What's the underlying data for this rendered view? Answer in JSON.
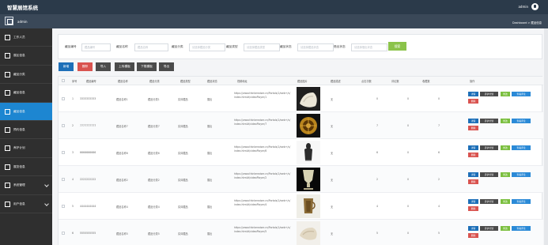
{
  "app": {
    "title": "智慧展馆系统",
    "user": "admin",
    "home_label": "admin",
    "breadcrumb": "Dashboard > 藏品信息"
  },
  "sidebar": {
    "items": [
      {
        "label": "工作人员",
        "active": false,
        "icon": "user-icon",
        "arrow": false
      },
      {
        "label": "展区信息",
        "active": false,
        "icon": "photo-icon",
        "arrow": false
      },
      {
        "label": "藏品分类",
        "active": false,
        "icon": "list-icon",
        "arrow": false
      },
      {
        "label": "藏品信息",
        "active": false,
        "icon": "grid-icon",
        "arrow": false
      },
      {
        "label": "藏品信息",
        "active": true,
        "icon": "grid-icon",
        "arrow": false
      },
      {
        "label": "预约信息",
        "active": false,
        "icon": "send-icon",
        "arrow": false
      },
      {
        "label": "养护计划",
        "active": false,
        "icon": "check-icon",
        "arrow": false
      },
      {
        "label": "展览信息",
        "active": false,
        "icon": "edit-icon",
        "arrow": false
      },
      {
        "label": "系统管理",
        "active": false,
        "icon": "file-icon",
        "arrow": true
      },
      {
        "label": "用户信息",
        "active": false,
        "icon": "chat-icon",
        "arrow": true
      }
    ]
  },
  "filters": [
    {
      "label": "藏品编号",
      "placeholder": "藏品编号"
    },
    {
      "label": "藏品名称",
      "placeholder": "藏品名称"
    },
    {
      "label": "藏品分类",
      "placeholder": "请选择藏品分类"
    },
    {
      "label": "藏品类型",
      "placeholder": "请选择藏品类型"
    },
    {
      "label": "藏品状态",
      "placeholder": "请选择藏品状态"
    },
    {
      "label": "借出状态",
      "placeholder": "请选择借出状态"
    }
  ],
  "search_label": "搜索",
  "actions": [
    {
      "label": "新增",
      "color": "#1d6fb8"
    },
    {
      "label": "删除",
      "color": "#d9534f"
    },
    {
      "label": "导入",
      "color": "#4b4b4b"
    },
    {
      "label": "上传模板",
      "color": "#4b4b4b"
    },
    {
      "label": "下载模板",
      "color": "#4b4b4b"
    },
    {
      "label": "导出",
      "color": "#4b4b4b"
    }
  ],
  "table": {
    "headers": [
      "序号",
      "藏品编号",
      "藏品名称",
      "藏品分类",
      "藏品类型",
      "藏品状态",
      "视频地址",
      "藏品图片",
      "藏品描述",
      "点击次数",
      "评论数",
      "收藏数",
      "操作"
    ],
    "rows": [
      {
        "no": "1",
        "code": "3333333333",
        "name": "藏品名称1",
        "category": "藏品分类1",
        "type": "实体藏品",
        "status": "展出",
        "url": "https://www.thinkerwiser.cn/Portals/1/web+/v/index.html#/videoPlayer/1",
        "desc": "无",
        "clicks": "0",
        "comments": "0",
        "favorites": "0",
        "thumb": "cream"
      },
      {
        "no": "2",
        "code": "7777777777",
        "name": "藏品名称7",
        "category": "藏品分类7",
        "type": "实体藏品",
        "status": "展出",
        "url": "https://www.thinkerwiser.cn/Portals/1/web+/v/index.html#/videoPlayer/7",
        "desc": "无",
        "clicks": "7",
        "comments": "0",
        "favorites": "7",
        "thumb": "bronze"
      },
      {
        "no": "3",
        "code": "6666666666",
        "name": "藏品名称6",
        "category": "藏品分类6",
        "type": "实体藏品",
        "status": "展出",
        "url": "https://www.thinkerwiser.cn/Portals/1/web+/v/index.html#/videoPlayer/6",
        "desc": "无",
        "clicks": "6",
        "comments": "0",
        "favorites": "6",
        "thumb": "figure"
      },
      {
        "no": "4",
        "code": "2222222222",
        "name": "藏品名称2",
        "category": "藏品分类2",
        "type": "实体藏品",
        "status": "展出",
        "url": "https://www.thinkerwiser.cn/Portals/1/web+/v/index.html#/videoPlayer/2",
        "desc": "无",
        "clicks": "2",
        "comments": "0",
        "favorites": "2",
        "thumb": "vessel"
      },
      {
        "no": "5",
        "code": "4444444444",
        "name": "藏品名称4",
        "category": "藏品分类4",
        "type": "实体藏品",
        "status": "展出",
        "url": "https://www.thinkerwiser.cn/Portals/1/web+/v/index.html#/videoPlayer/4",
        "desc": "无",
        "clicks": "4",
        "comments": "0",
        "favorites": "4",
        "thumb": "cup"
      },
      {
        "no": "6",
        "code": "5555555555",
        "name": "藏品名称5",
        "category": "藏品分类5",
        "type": "实体藏品",
        "status": "展出",
        "url": "https://www.thinkerwiser.cn/Portals/1/web+/v/index.html#/videoPlayer/5",
        "desc": "无",
        "clicks": "5",
        "comments": "0",
        "favorites": "5",
        "thumb": "stone"
      }
    ],
    "buttons": {
      "detail": "详情",
      "plan": "养护计划",
      "edit": "修改",
      "comments": "查看评论",
      "delete": "删除"
    }
  }
}
